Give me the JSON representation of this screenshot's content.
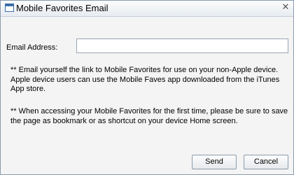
{
  "window": {
    "title": "Mobile Favorites Email",
    "close_glyph": "✕",
    "icon": "window-icon"
  },
  "form": {
    "email_label": "Email Address:",
    "email_value": "",
    "email_placeholder": ""
  },
  "notes": {
    "note1": "** Email yourself the link to Mobile Favorites for use on your non-Apple device. Apple device users can use the Mobile Faves app downloaded from the iTunes App store.",
    "note2": "** When accessing your Mobile Favorites for the first time, please be sure to save the page as bookmark or as shortcut on your device Home screen."
  },
  "buttons": {
    "send_label": "Send",
    "cancel_label": "Cancel"
  }
}
